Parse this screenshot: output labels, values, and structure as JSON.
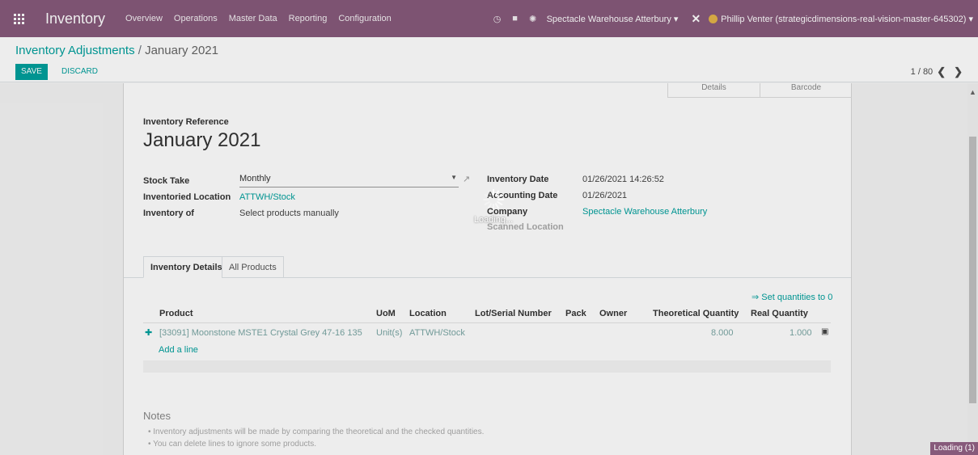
{
  "navbar": {
    "app_name": "Inventory",
    "menus": [
      "Overview",
      "Operations",
      "Master Data",
      "Reporting",
      "Configuration"
    ],
    "company": "Spectacle Warehouse Atterbury",
    "user": "Phillip Venter (strategicdimensions-real-vision-master-645302)",
    "icons": [
      "clock-icon",
      "chat-icon",
      "bug-icon"
    ]
  },
  "control_panel": {
    "breadcrumb_parent": "Inventory Adjustments",
    "breadcrumb_sep": "/",
    "breadcrumb_current": "January 2021",
    "save_label": "SAVE",
    "discard_label": "DISCARD",
    "pager": "1 / 80"
  },
  "form": {
    "smart_buttons": [
      "Details",
      "Barcode"
    ],
    "reference_label": "Inventory Reference",
    "title": "January 2021",
    "stock_take_label": "Stock Take",
    "stock_take_value": "Monthly",
    "location_label": "Inventoried Location",
    "location_value": "ATTWH/Stock",
    "inventory_of_label": "Inventory of",
    "inventory_of_value": "Select products manually",
    "inventory_date_label": "Inventory Date",
    "inventory_date_value": "01/26/2021 14:26:52",
    "accounting_date_label": "Accounting Date",
    "accounting_date_value": "01/26/2021",
    "company_label": "Company",
    "company_value": "Spectacle Warehouse Atterbury",
    "scanned_location_label": "Scanned Location"
  },
  "tabs": [
    "Inventory Details",
    "All Products"
  ],
  "table": {
    "set_quantities": "⇒ Set quantities to 0",
    "headers": [
      "Product",
      "UoM",
      "Location",
      "Lot/Serial Number",
      "Pack",
      "Owner",
      "Theoretical Quantity",
      "Real Quantity"
    ],
    "rows": [
      {
        "product": "[33091] Moonstone MSTE1 Crystal Grey 47-16 135",
        "uom": "Unit(s)",
        "location": "ATTWH/Stock",
        "theoretical": "8.000",
        "real": "1.000"
      }
    ],
    "add_line": "Add a line"
  },
  "notes": {
    "title": "Notes",
    "lines": [
      "• Inventory adjustments will be made by comparing the theoretical and the checked quantities.",
      "• You can delete lines to ignore some products."
    ]
  },
  "loading": {
    "text": "Loading...",
    "badge": "Loading (1)"
  },
  "colors": {
    "navbar": "#875a7b",
    "accent": "#00a09d"
  }
}
